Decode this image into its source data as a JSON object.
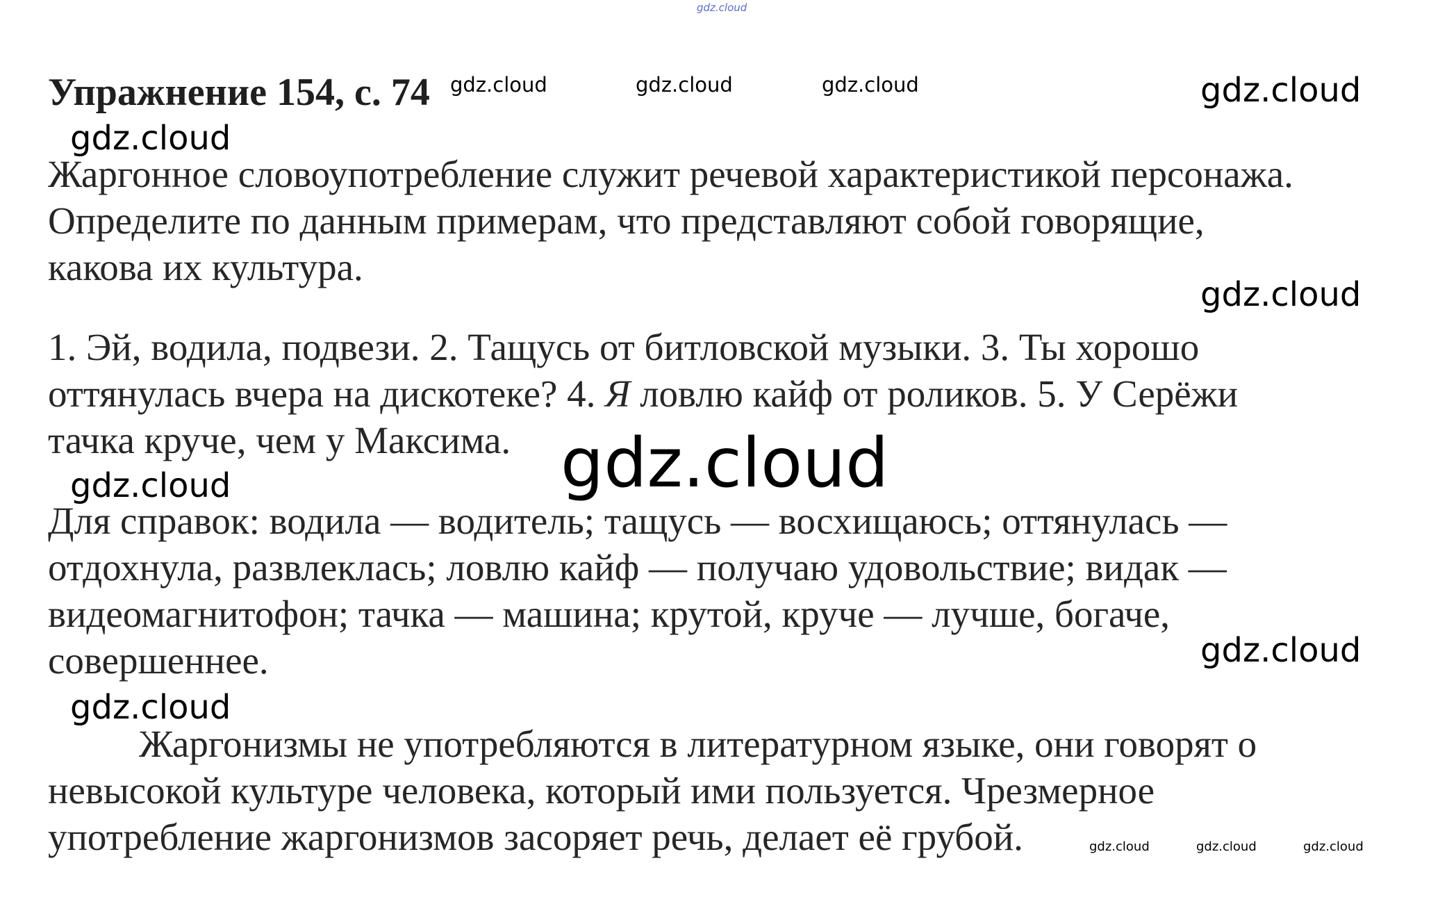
{
  "title": "Упражнение 154, с. 74",
  "task": {
    "lines": [
      "Жаргонное словоупотребление служит речевой характеристикой персонажа.",
      "Определите по данным примерам, что представляют собой говорящие,",
      "какова их культура."
    ]
  },
  "examples": {
    "line1": "1. Эй, водила, подвези. 2. Тащусь от битловской музыки. 3. Ты хорошо",
    "line2_before": "оттянулась вчера на дискотеке? 4. ",
    "line2_italic": "Я",
    "line2_after": " ловлю кайф от роликов. 5. У Серёжи",
    "line3": "тачка круче, чем у Максима."
  },
  "reference": {
    "lines": [
      "Для справок: водила — водитель; тащусь — восхищаюсь; оттянулась —",
      "отдохнула, развлеклась; ловлю кайф — получаю удовольствие; видак —",
      "видеомагнитофон; тачка — машина; крутой, круче — лучше, богаче,",
      "совершеннее."
    ]
  },
  "answer": {
    "lines": [
      "Жаргонизмы не употребляются в литературном языке, они говорят о",
      "невысокой культуре человека, который ими пользуется. Чрезмерное",
      "употребление жаргонизмов засоряет речь, делает её грубой."
    ]
  },
  "watermarks": {
    "top": "gdz.cloud",
    "title_row": [
      "gdz.cloud",
      "gdz.cloud",
      "gdz.cloud"
    ],
    "right_large": [
      "gdz.cloud",
      "gdz.cloud",
      "gdz.cloud"
    ],
    "left_medium": [
      "gdz.cloud",
      "gdz.cloud",
      "gdz.cloud"
    ],
    "center_big": "gdz.cloud",
    "bottom_small": [
      "gdz.cloud",
      "gdz.cloud",
      "gdz.cloud"
    ]
  }
}
